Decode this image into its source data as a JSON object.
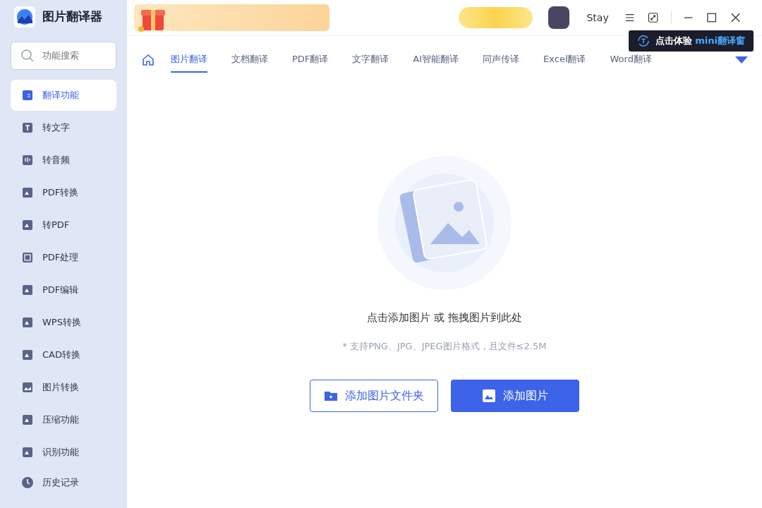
{
  "app": {
    "title": "图片翻译器"
  },
  "search": {
    "placeholder": "功能搜索"
  },
  "sidebar": {
    "items": [
      {
        "label": "翻译功能",
        "kind": "translate",
        "selected": true
      },
      {
        "label": "转文字",
        "kind": "text",
        "selected": false
      },
      {
        "label": "转音频",
        "kind": "audio",
        "selected": false
      },
      {
        "label": "PDF转换",
        "kind": "document",
        "selected": false
      },
      {
        "label": "转PDF",
        "kind": "document",
        "selected": false
      },
      {
        "label": "PDF处理",
        "kind": "chip",
        "selected": false
      },
      {
        "label": "PDF编辑",
        "kind": "document",
        "selected": false
      },
      {
        "label": "WPS转换",
        "kind": "document",
        "selected": false
      },
      {
        "label": "CAD转换",
        "kind": "document",
        "selected": false
      },
      {
        "label": "图片转换",
        "kind": "image",
        "selected": false
      },
      {
        "label": "压缩功能",
        "kind": "document",
        "selected": false
      },
      {
        "label": "识别功能",
        "kind": "document",
        "selected": false
      }
    ],
    "history": {
      "label": "历史记录"
    }
  },
  "header": {
    "user": "Stay"
  },
  "tooltip": {
    "prefix": "点击体验",
    "highlight": "mini翻译窗"
  },
  "tabs": [
    {
      "label": "图片翻译",
      "selected": true
    },
    {
      "label": "文档翻译",
      "selected": false
    },
    {
      "label": "PDF翻译",
      "selected": false
    },
    {
      "label": "文字翻译",
      "selected": false
    },
    {
      "label": "AI智能翻译",
      "selected": false
    },
    {
      "label": "同声传译",
      "selected": false
    },
    {
      "label": "Excel翻译",
      "selected": false
    },
    {
      "label": "Word翻译",
      "selected": false
    }
  ],
  "upload": {
    "title": "点击添加图片 或 拖拽图片到此处",
    "hint": "* 支持PNG、JPG、JPEG图片格式，且文件≤2.5M",
    "buttons": [
      {
        "label": "添加图片文件夹",
        "kind": "outline"
      },
      {
        "label": "添加图片",
        "kind": "primary"
      }
    ]
  }
}
